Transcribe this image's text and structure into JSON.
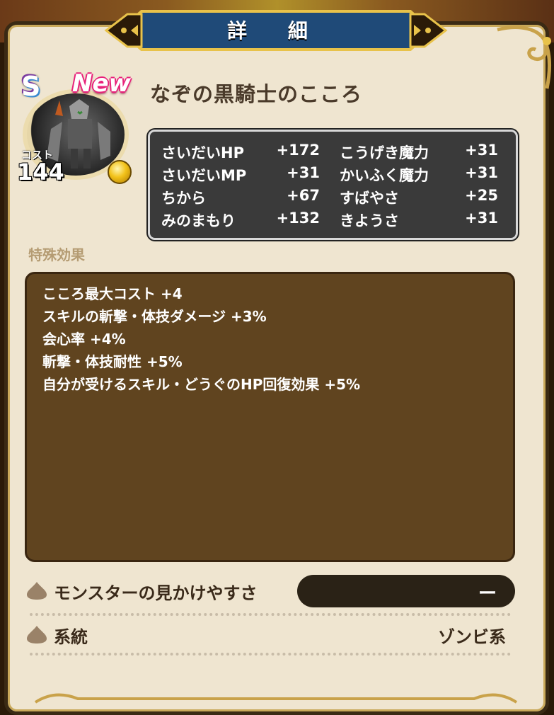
{
  "header": {
    "title": "詳 細"
  },
  "item": {
    "name": "なぞの黒騎士のこころ",
    "rank": "S",
    "new_tag": "New",
    "cost_label": "コスト",
    "cost": "144"
  },
  "stats": [
    {
      "label": "さいだいHP",
      "value": "+172"
    },
    {
      "label": "こうげき魔力",
      "value": "+31"
    },
    {
      "label": "さいだいMP",
      "value": "+31"
    },
    {
      "label": "かいふく魔力",
      "value": "+31"
    },
    {
      "label": "ちから",
      "value": "+67"
    },
    {
      "label": "すばやさ",
      "value": "+25"
    },
    {
      "label": "みのまもり",
      "value": "+132"
    },
    {
      "label": "きようさ",
      "value": "+31"
    }
  ],
  "special": {
    "label": "特殊効果",
    "effects": [
      "こころ最大コスト +4",
      "スキルの斬撃・体技ダメージ +3%",
      "会心率 +4%",
      "斬撃・体技耐性 +5%",
      "自分が受けるスキル・どうぐのHP回復効果 +5%"
    ]
  },
  "visibility": {
    "label": "モンスターの見かけやすさ",
    "value": "ー"
  },
  "lineage": {
    "label": "系統",
    "value": "ゾンビ系"
  },
  "colors": {
    "panel": "#60441f",
    "background": "#efe5d0",
    "stats_bg": "#3a3a3a"
  }
}
